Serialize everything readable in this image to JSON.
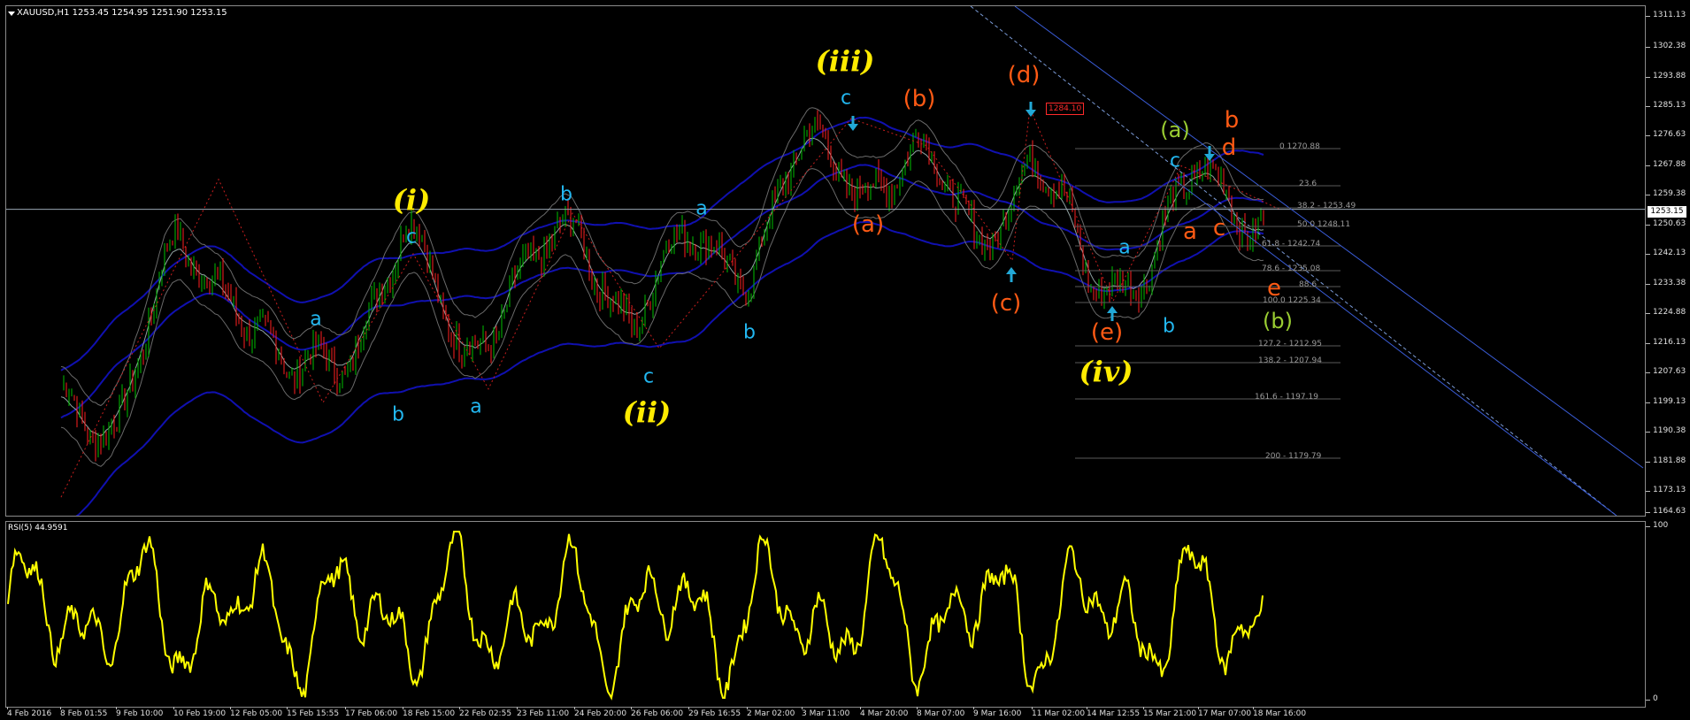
{
  "header": {
    "symbol": "XAUUSD,H1",
    "ohlc": "1253.45 1254.95 1251.90 1253.15"
  },
  "price_axis": [
    "1311.13",
    "1302.38",
    "1293.88",
    "1285.13",
    "1276.63",
    "1267.88",
    "1259.38",
    "1250.63",
    "1242.13",
    "1233.38",
    "1224.88",
    "1216.13",
    "1207.63",
    "1199.13",
    "1190.38",
    "1181.88",
    "1173.13",
    "1164.63"
  ],
  "current_price": "1253.15",
  "rsi": {
    "label": "RSI(5) 44.9591",
    "axis_top": "100",
    "axis_bottom": "0",
    "line_color": "#ffff00"
  },
  "time_axis": [
    "4 Feb 2016",
    "8 Feb 01:55",
    "9 Feb 10:00",
    "10 Feb 19:00",
    "12 Feb 05:00",
    "15 Feb 15:55",
    "17 Feb 06:00",
    "18 Feb 15:00",
    "22 Feb 02:55",
    "23 Feb 11:00",
    "24 Feb 20:00",
    "26 Feb 06:00",
    "29 Feb 16:55",
    "2 Mar 02:00",
    "3 Mar 11:00",
    "4 Mar 20:00",
    "8 Mar 07:00",
    "9 Mar 16:00",
    "11 Mar 02:00",
    "14 Mar 12:55",
    "15 Mar 21:00",
    "17 Mar 07:00",
    "18 Mar 16:00"
  ],
  "high_tag": "1284.10",
  "fib_levels": [
    "0 1270.88",
    "23.6",
    "38.2 - 1253.49",
    "50.0 1248.11",
    "61.8 - 1242.74",
    "78.6 - 1235.08",
    "88.6",
    "100.0 1225.34",
    "127.2 - 1212.95",
    "138.2 - 1207.94",
    "161.6 - 1197.19",
    "200 - 1179.79"
  ],
  "wave_labels": {
    "iii": "(iii)",
    "i": "(i)",
    "ii": "(ii)",
    "iv": "(iv)",
    "c_top": "c",
    "b_paren": "(b)",
    "d_paren": "(d)",
    "a_paren": "(a)",
    "c_paren": "(c)",
    "e_paren": "(e)",
    "c1": "c",
    "b1": "b",
    "a1": "a",
    "b2": "b",
    "a2": "a",
    "a3": "a",
    "b3": "b",
    "c3": "c",
    "a4": "a",
    "b4": "b",
    "c4": "c",
    "a5": "a",
    "green_a": "(a)",
    "green_b": "(b)",
    "red_b": "b",
    "red_d": "d",
    "red_a": "a",
    "red_c": "c",
    "red_e": "e"
  },
  "colors": {
    "background": "#000000",
    "bull_candle": "#00c000",
    "bear_candle": "#ff2020",
    "bollinger": "#1010b0",
    "rsi_line": "#ffff00",
    "wave_cyan": "#22b7f0",
    "wave_orange": "#ff5a14",
    "wave_yellow": "#ffeb00",
    "wave_green": "#9acd32"
  },
  "chart_data": {
    "type": "line",
    "title": "XAUUSD,H1",
    "ylim": [
      1164.63,
      1311.13
    ],
    "x": [
      "4 Feb 2016",
      "8 Feb 01:55",
      "9 Feb 10:00",
      "10 Feb 19:00",
      "12 Feb 05:00",
      "15 Feb 15:55",
      "17 Feb 06:00",
      "18 Feb 15:00",
      "22 Feb 02:55",
      "23 Feb 11:00",
      "24 Feb 20:00",
      "26 Feb 06:00",
      "29 Feb 16:55",
      "2 Mar 02:00",
      "3 Mar 11:00",
      "4 Mar 20:00",
      "8 Mar 07:00",
      "9 Mar 16:00",
      "11 Mar 02:00",
      "14 Mar 12:55",
      "15 Mar 21:00",
      "17 Mar 07:00",
      "18 Mar 16:00"
    ],
    "series": [
      {
        "values": [
          1168,
          1196,
          1192,
          1240,
          1232,
          1200,
          1213,
          1245,
          1212,
          1232,
          1246,
          1222,
          1243,
          1238,
          1270,
          1263,
          1268,
          1246,
          1268,
          1232,
          1237,
          1262,
          1253.15
        ]
      }
    ],
    "grid": false
  }
}
